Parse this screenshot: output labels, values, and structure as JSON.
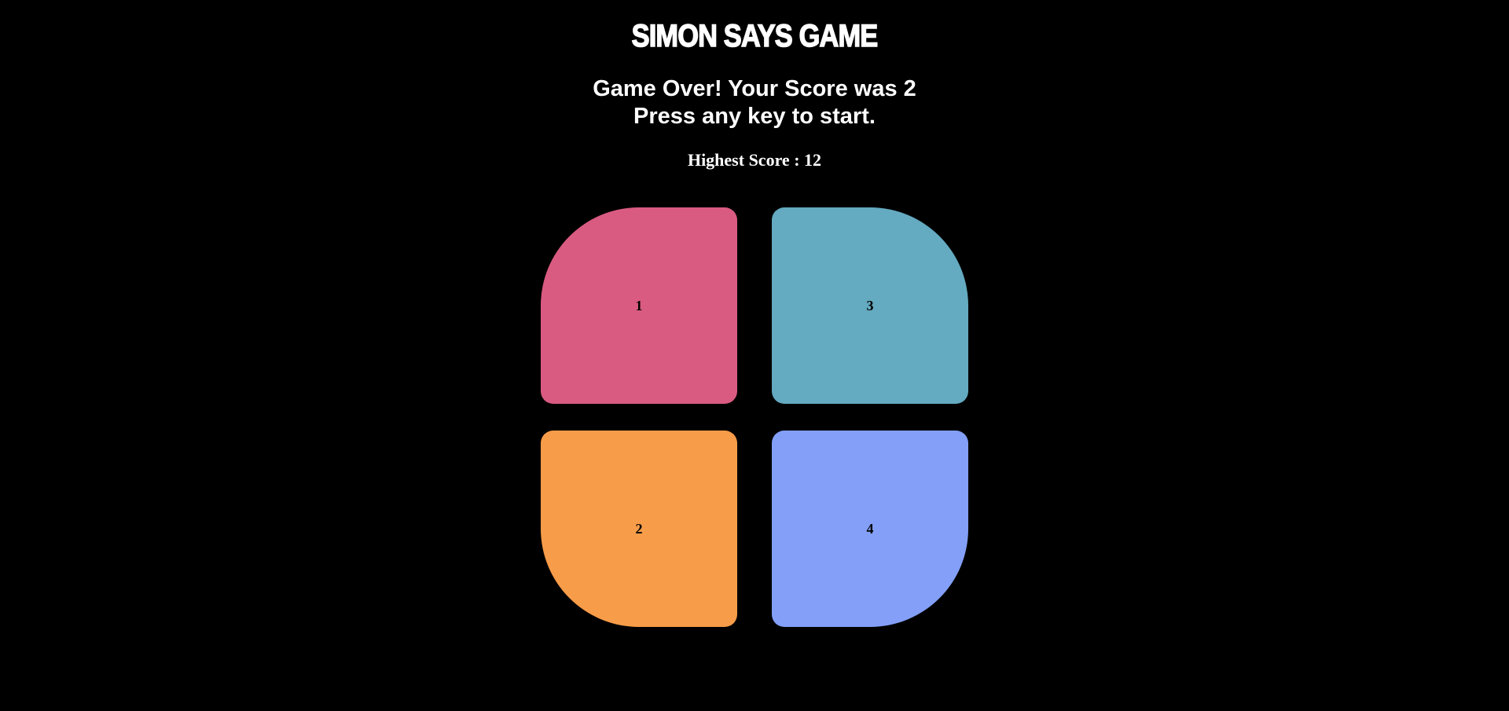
{
  "game": {
    "title": "SIMON SAYS GAME",
    "status_line_1": "Game Over! Your Score was 2",
    "status_line_2": "Press any key to start.",
    "high_score": "Highest Score : 12"
  },
  "pads": [
    {
      "label": "1",
      "color": "#DA5B81"
    },
    {
      "label": "2",
      "color": "#F79C49"
    },
    {
      "label": "3",
      "color": "#64AAC0"
    },
    {
      "label": "4",
      "color": "#839FF8"
    }
  ],
  "colors": {
    "background": "#000000",
    "text": "#FFFFFF"
  }
}
